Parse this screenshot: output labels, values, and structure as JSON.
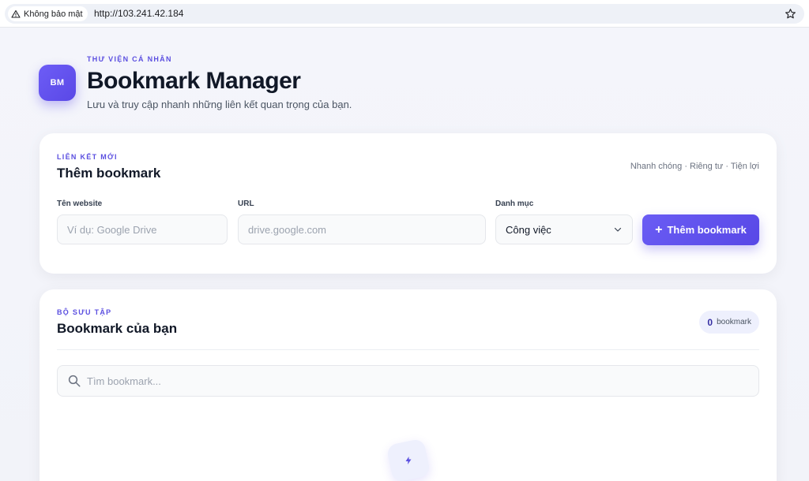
{
  "browser": {
    "security_label": "Không bảo mật",
    "url": "http://103.241.42.184",
    "bookmark_star_icon": "star-icon",
    "warning_icon": "warning-icon"
  },
  "header": {
    "logo_text": "BM",
    "eyebrow": "THƯ VIỆN CÁ NHÂN",
    "title": "Bookmark Manager",
    "subtitle": "Lưu và truy cập nhanh những liên kết quan trọng của bạn."
  },
  "add_card": {
    "eyebrow": "LIÊN KẾT MỚI",
    "title": "Thêm bookmark",
    "tagline": "Nhanh chóng · Riêng tư · Tiện lợi",
    "fields": {
      "name_label": "Tên website",
      "name_placeholder": "Ví dụ: Google Drive",
      "url_label": "URL",
      "url_placeholder": "drive.google.com",
      "category_label": "Danh mục",
      "category_value": "Công việc"
    },
    "submit_label": "Thêm bookmark",
    "submit_icon": "plus-icon"
  },
  "list_card": {
    "eyebrow": "BỘ SƯU TẬP",
    "title": "Bookmark của bạn",
    "count_value": "0",
    "count_unit": "bookmark",
    "search_placeholder": "Tìm bookmark...",
    "search_icon": "search-icon",
    "empty_icon": "lightning-icon"
  },
  "colors": {
    "accent": "#5b4fe0",
    "page_bg": "#f3f4fa",
    "card_bg": "#ffffff"
  }
}
